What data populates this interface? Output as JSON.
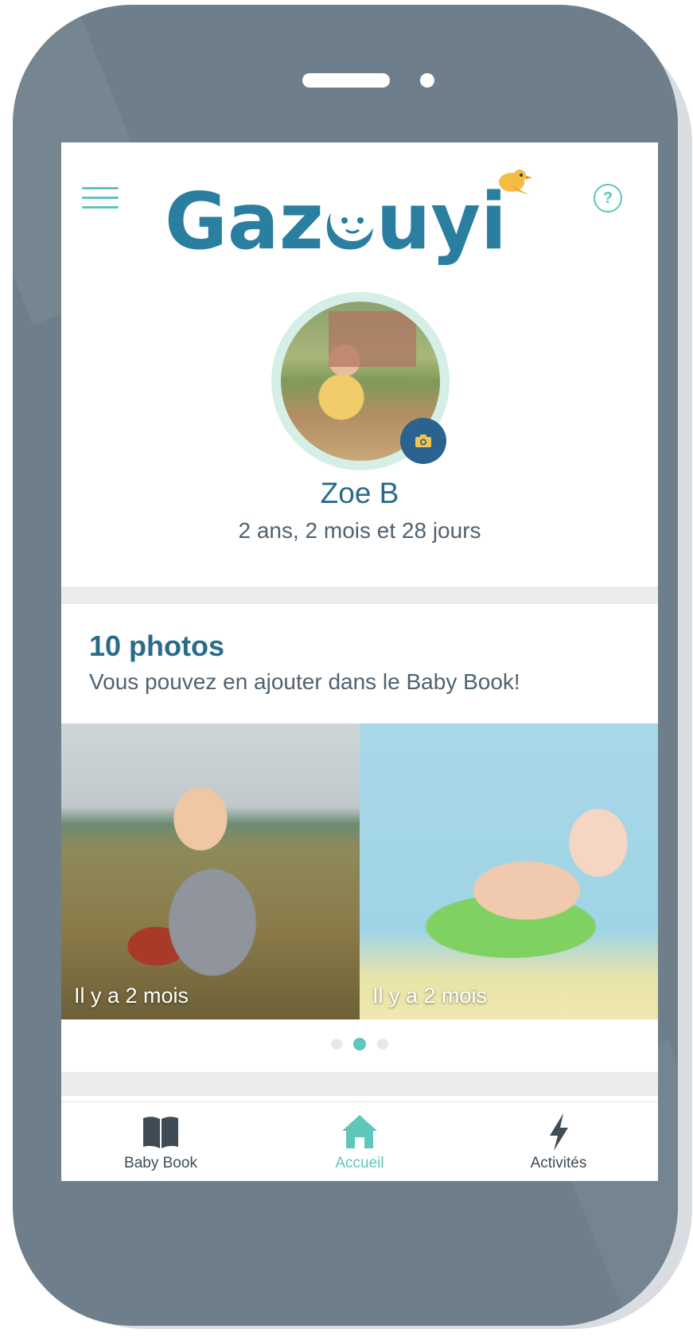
{
  "header": {
    "logo_text": "Gazouyi",
    "help_symbol": "?"
  },
  "profile": {
    "name": "Zoe B",
    "age": "2 ans, 2 mois et 28 jours"
  },
  "photos": {
    "title": "10 photos",
    "subtitle": "Vous pouvez en ajouter dans le Baby Book!",
    "items": [
      {
        "label": "Il y a 2 mois"
      },
      {
        "label": "Il y a 2 mois"
      }
    ],
    "active_page": 2,
    "page_count": 3
  },
  "tabs": [
    {
      "label": "Baby Book",
      "icon": "book-icon"
    },
    {
      "label": "Accueil",
      "icon": "home-icon",
      "active": true
    },
    {
      "label": "Activités",
      "icon": "lightning-icon"
    }
  ],
  "colors": {
    "brand_blue": "#2a6b8a",
    "accent_teal": "#5fc6bb",
    "phone_body": "#6e7f8b",
    "camera_button": "#2a6390"
  }
}
